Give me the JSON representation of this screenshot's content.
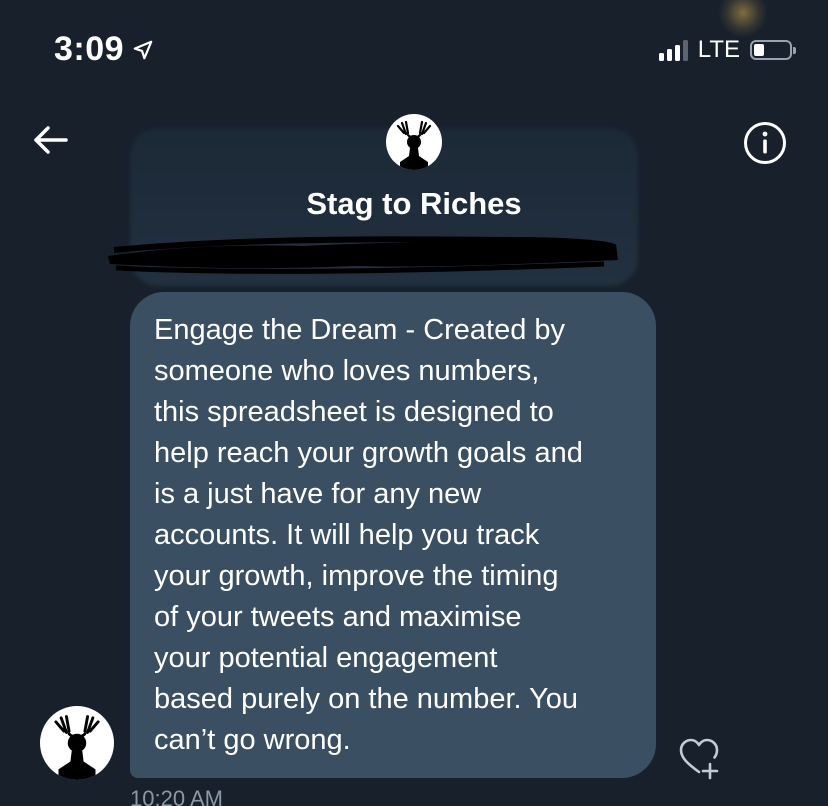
{
  "status_bar": {
    "time": "3:09",
    "network": "LTE",
    "location_icon": "location-arrow-icon",
    "signal_bars_active": 3,
    "signal_bars_total": 4,
    "battery_level": 0.2
  },
  "header": {
    "title": "Stag to Riches",
    "back_icon": "back-arrow-icon",
    "info_icon": "info-icon"
  },
  "message": {
    "text": "Engage the Dream - Created by\nsomeone who loves numbers,\nthis spreadsheet is designed to\nhelp reach your growth goals and\nis a just have for any new\naccounts. It will help you track\nyour growth, improve the timing\nof your tweets and maximise\nyour potential engagement\nbased purely on the number. You\ncan’t go wrong.",
    "timestamp": "10:20 AM",
    "like_icon": "heart-plus-icon"
  },
  "colors": {
    "background": "#17202b",
    "bubble": "#3a4f62",
    "timestamp": "#8b98a5"
  }
}
